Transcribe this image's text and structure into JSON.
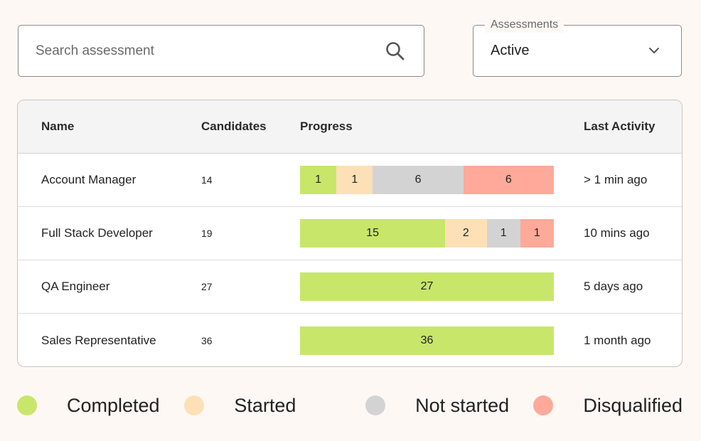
{
  "search": {
    "placeholder": "Search assessment",
    "value": "",
    "icon": "search-icon"
  },
  "filter": {
    "label": "Assessments",
    "selected": "Active",
    "icon": "chevron-down-icon"
  },
  "colors": {
    "completed": "#c8e66a",
    "started": "#fde0b6",
    "not_started": "#d3d3d3",
    "disqualified": "#fea999"
  },
  "table": {
    "headers": {
      "name": "Name",
      "candidates": "Candidates",
      "progress": "Progress",
      "last_activity": "Last Activity"
    },
    "rows": [
      {
        "name": "Account Manager",
        "candidates": "14",
        "last_activity": "> 1 min ago",
        "progress": {
          "completed": 1,
          "started": 1,
          "not_started": 6,
          "disqualified": 6
        }
      },
      {
        "name": "Full Stack Developer",
        "candidates": "19",
        "last_activity": "10 mins ago",
        "progress": {
          "completed": 15,
          "started": 2,
          "not_started": 1,
          "disqualified": 1
        }
      },
      {
        "name": "QA Engineer",
        "candidates": "27",
        "last_activity": "5 days ago",
        "progress": {
          "completed": 27,
          "started": 0,
          "not_started": 0,
          "disqualified": 0
        }
      },
      {
        "name": "Sales Representative",
        "candidates": "36",
        "last_activity": "1 month ago",
        "progress": {
          "completed": 36,
          "started": 0,
          "not_started": 0,
          "disqualified": 0
        }
      }
    ]
  },
  "legend": [
    {
      "key": "completed",
      "label": "Completed"
    },
    {
      "key": "started",
      "label": "Started"
    },
    {
      "key": "not_started",
      "label": "Not started"
    },
    {
      "key": "disqualified",
      "label": "Disqualified"
    }
  ]
}
